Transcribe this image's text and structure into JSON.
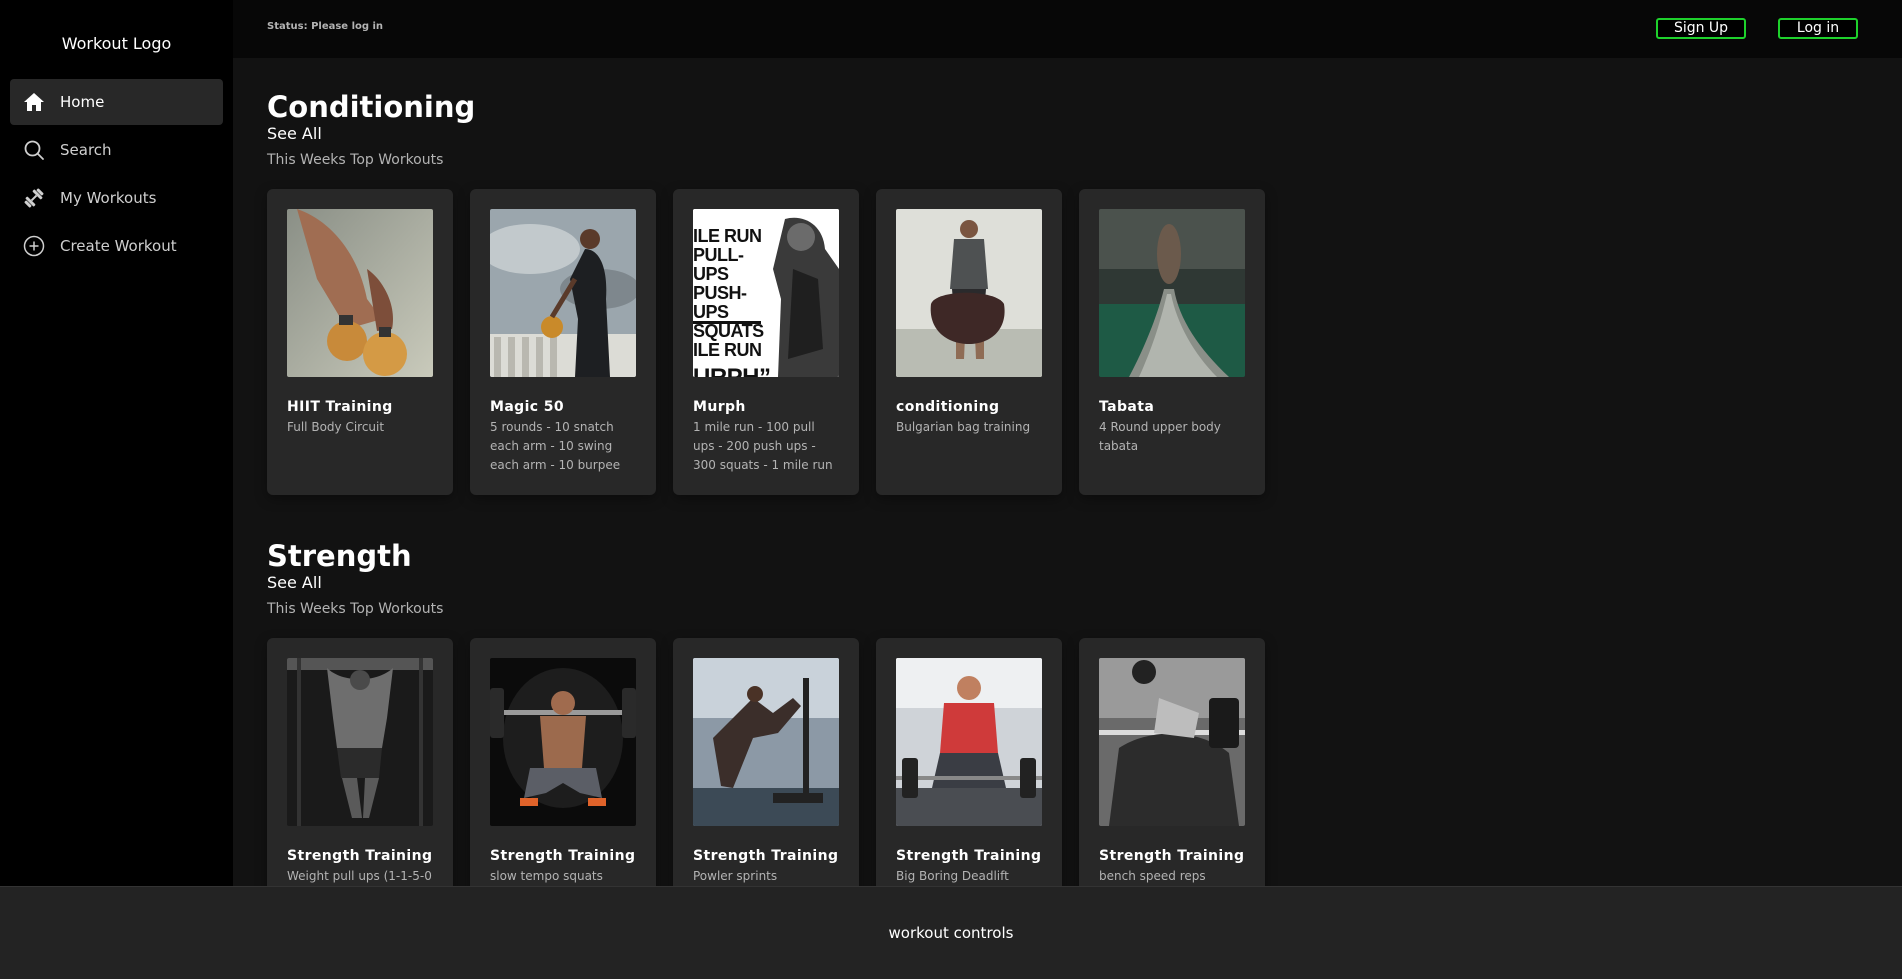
{
  "logo": "Workout Logo",
  "nav": [
    {
      "label": "Home",
      "icon": "home-icon",
      "active": true
    },
    {
      "label": "Search",
      "icon": "search-icon",
      "active": false
    },
    {
      "label": "My Workouts",
      "icon": "dumbbell-icon",
      "active": false
    },
    {
      "label": "Create Workout",
      "icon": "plus-circle-icon",
      "active": false
    }
  ],
  "topbar": {
    "status": "Status: Please log in",
    "signup_label": "Sign Up",
    "login_label": "Log in",
    "button_border_color": "#1ed12c"
  },
  "sections": [
    {
      "title": "Conditioning",
      "see_all": "See All",
      "subtitle": "This Weeks Top Workouts",
      "cards": [
        {
          "title": "HIIT Training",
          "desc": "Full Body Circuit"
        },
        {
          "title": "Magic 50",
          "desc": "5 rounds - 10 snatch each arm - 10 swing each arm - 10 burpee"
        },
        {
          "title": "Murph",
          "desc": "1 mile run - 100 pull ups - 200 push ups - 300 squats - 1 mile run"
        },
        {
          "title": "conditioning",
          "desc": "Bulgarian bag training"
        },
        {
          "title": "Tabata",
          "desc": "4 Round upper body tabata"
        }
      ]
    },
    {
      "title": "Strength",
      "see_all": "See All",
      "subtitle": "This Weeks Top Workouts",
      "cards": [
        {
          "title": "Strength Training",
          "desc": "Weight pull ups (1-1-5-0"
        },
        {
          "title": "Strength Training",
          "desc": "slow tempo squats"
        },
        {
          "title": "Strength Training",
          "desc": "Powler sprints"
        },
        {
          "title": "Strength Training",
          "desc": "Big Boring Deadlift"
        },
        {
          "title": "Strength Training",
          "desc": "bench speed reps"
        }
      ]
    }
  ],
  "murph_image_text": [
    "ILE RUN",
    "PULL-UPS",
    "PUSH-UPS",
    "SQUATS",
    "ILE RUN",
    "URPH”"
  ],
  "footer": "workout controls"
}
